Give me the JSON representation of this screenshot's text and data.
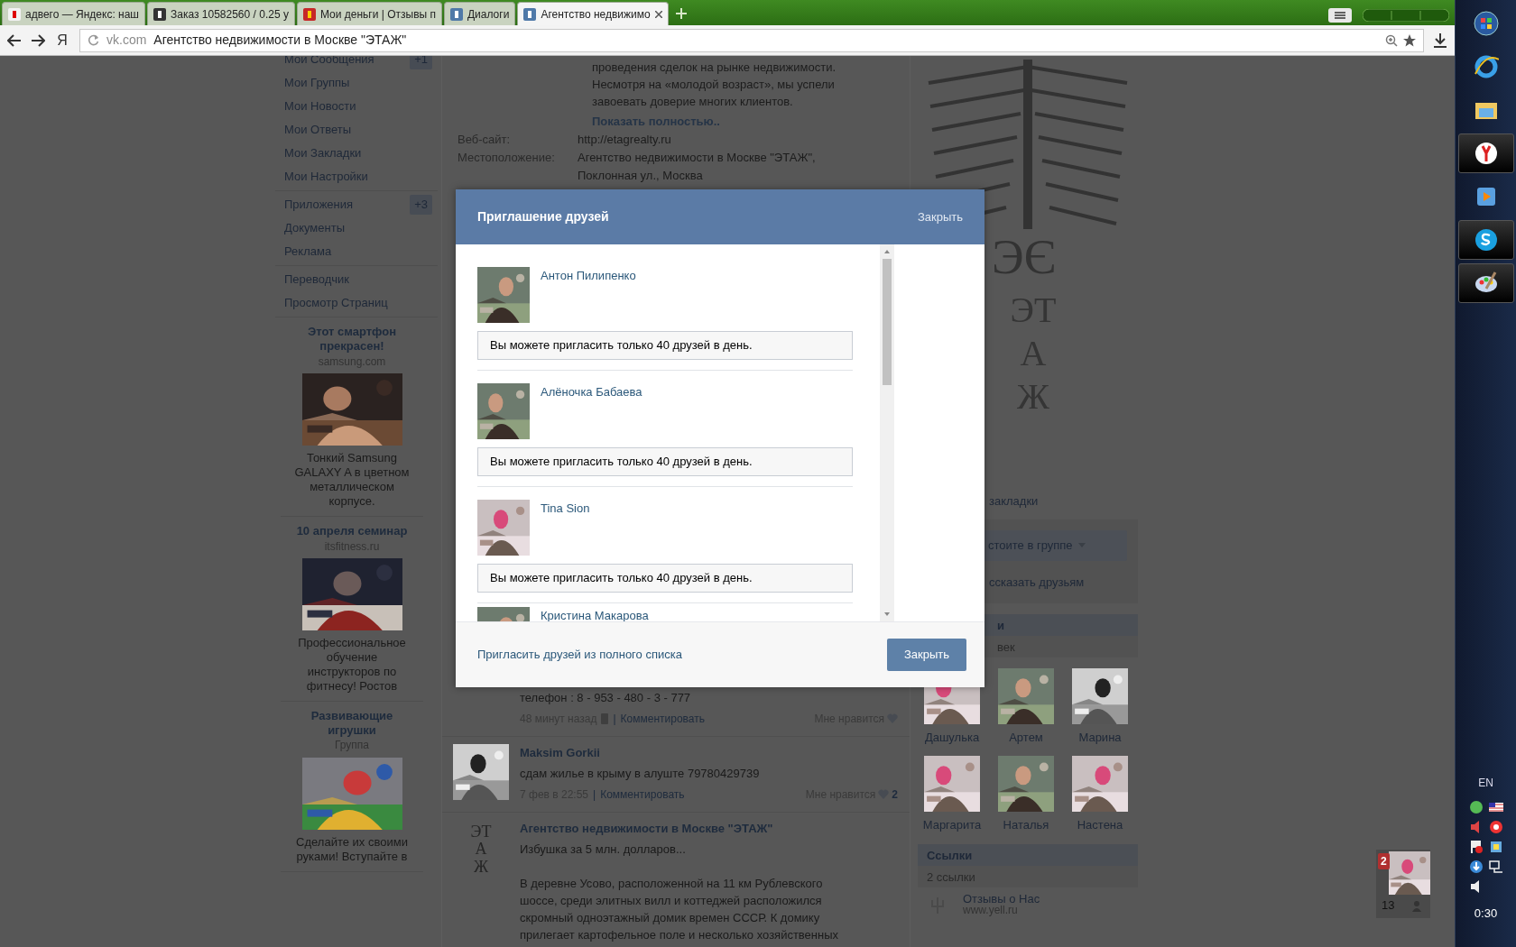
{
  "browser": {
    "tabs": [
      {
        "label": "адвего — Яндекс: наш",
        "selected": false
      },
      {
        "label": "Заказ 10582560 / 0.25 у",
        "selected": false
      },
      {
        "label": "Мои деньги | Отзывы п",
        "selected": false
      },
      {
        "label": "Диалоги",
        "selected": false
      },
      {
        "label": "Агентство недвижимо",
        "selected": true
      }
    ],
    "yandex_button": "Я",
    "address": {
      "host": "vk.com",
      "title": "Агентство недвижимости в Москве \"ЭТАЖ\""
    }
  },
  "sidebar": {
    "menu_groups": [
      {
        "items": [
          {
            "label": "Мои Сообщения",
            "badge": "+1"
          },
          {
            "label": "Мои Группы"
          },
          {
            "label": "Мои Новости"
          },
          {
            "label": "Мои Ответы"
          },
          {
            "label": "Мои Закладки"
          },
          {
            "label": "Мои Настройки"
          }
        ]
      },
      {
        "items": [
          {
            "label": "Приложения",
            "badge": "+3"
          },
          {
            "label": "Документы"
          },
          {
            "label": "Реклама"
          }
        ]
      },
      {
        "items": [
          {
            "label": "Переводчик"
          },
          {
            "label": "Просмотр Страниц"
          }
        ]
      }
    ],
    "ads": [
      {
        "title": "Этот смартфон прекрасен!",
        "source": "samsung.com",
        "text": "Тонкий Samsung GALAXY A в цветном металлическом корпусе."
      },
      {
        "title": "10 апреля семинар",
        "source": "itsfitness.ru",
        "text": "Профессиональное обучение инструкторов по фитнесу! Ростов"
      },
      {
        "title": "Развивающие игрушки",
        "source": "Группа",
        "text": "Сделайте их своими руками! Вступайте в"
      }
    ]
  },
  "profile": {
    "description_lines": [
      "проведения сделок на рынке недвижимости.",
      "Несмотря на «молодой возраст», мы успели",
      "завоевать доверие многих клиентов."
    ],
    "show_more": "Показать полностью..",
    "fields": [
      {
        "label": "Веб-сайт:",
        "values": [
          "http://etagrealty.ru"
        ]
      },
      {
        "label": "Местоположение:",
        "values": [
          "Агентство недвижимости в Москве \"ЭТАЖ\",",
          "Поклонная ул., Москва"
        ]
      }
    ]
  },
  "wall": [
    {
      "kind": "plain",
      "text": "телефон : 8 - 953 - 480 - 3 - 777",
      "time": "48 минут назад",
      "mobile": true,
      "separator": "|",
      "comment": "Комментировать",
      "like": "Мне нравится"
    },
    {
      "kind": "picture",
      "author": "Maksim Gorkii",
      "text": "сдам жилье в крыму в алуште 79780429739",
      "time": "7 фев в 22:55",
      "mobile": false,
      "separator": "|",
      "comment": "Комментировать",
      "like": "Мне нравится",
      "likes": "2"
    },
    {
      "kind": "logo",
      "logo_letters": "ЭТАЖ",
      "author": "Агентство недвижимости в Москве \"ЭТАЖ\"",
      "text": "Избушка за 5 млн. долларов...",
      "paragraph": "В деревне Усово, расположенной на 11 км Рублевского шоссе, среди элитных вилл и коттеджей расположился скромный одноэтажный домик времен СССР. К домику прилегает картофельное поле и несколько хозяйственных"
    }
  ],
  "right": {
    "logo": {
      "monogram": "ЭЄ",
      "letters": "ЭТАЖ"
    },
    "bookmark": "закладки",
    "member_button": "стоите в группе",
    "share": "ссказать друзьям",
    "members_header": "и",
    "members_count": "век",
    "friends": [
      {
        "name": "Дашулька"
      },
      {
        "name": "Артем"
      },
      {
        "name": "Марина"
      },
      {
        "name": "Маргарита"
      },
      {
        "name": "Наталья"
      },
      {
        "name": "Настена"
      }
    ],
    "links": {
      "title": "Ссылки",
      "count": "2 ссылки",
      "items": [
        {
          "title": "Отзывы о Нас",
          "url": "www.yell.ru"
        }
      ]
    }
  },
  "chat_widget": {
    "badge": "2",
    "count": "13"
  },
  "modal": {
    "title": "Приглашение друзей",
    "header_close": "Закрыть",
    "friends": [
      {
        "name": "Антон Пилипенко",
        "notice": "Вы можете пригласить только 40 друзей в день."
      },
      {
        "name": "Алёночка Бабаева",
        "notice": "Вы можете пригласить только 40 друзей в день."
      },
      {
        "name": "Tina Sion",
        "notice": "Вы можете пригласить только 40 друзей в день."
      },
      {
        "name": "Кристина Макарова"
      }
    ],
    "invite_link": "Пригласить друзей из полного списка",
    "close_button": "Закрыть"
  },
  "taskbar": {
    "apps": [
      {
        "kind": "start",
        "active": false
      },
      {
        "kind": "ie",
        "active": false
      },
      {
        "kind": "explorer",
        "active": false
      },
      {
        "kind": "yandex",
        "active": true
      },
      {
        "kind": "media",
        "active": false
      },
      {
        "kind": "skype",
        "active": true
      },
      {
        "kind": "paint",
        "active": true
      }
    ],
    "language": "EN",
    "clock": "0:30"
  }
}
